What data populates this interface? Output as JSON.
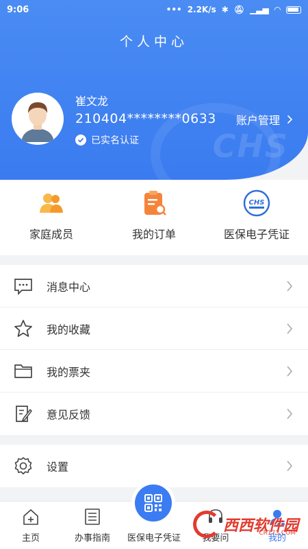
{
  "status_bar": {
    "time": "9:06",
    "speed": "2.2K/s"
  },
  "header": {
    "title": "个人中心",
    "user_name": "崔文龙",
    "user_id": "210404********0633",
    "verified_text": "已实名认证",
    "account_manage": "账户管理",
    "watermark": "CHS"
  },
  "quick_actions": [
    {
      "label": "家庭成员",
      "icon": "family-icon"
    },
    {
      "label": "我的订单",
      "icon": "order-icon"
    },
    {
      "label": "医保电子凭证",
      "icon": "chs-icon"
    }
  ],
  "chs_small_text": "CHS",
  "menu": [
    {
      "label": "消息中心",
      "icon": "message-icon"
    },
    {
      "label": "我的收藏",
      "icon": "star-icon"
    },
    {
      "label": "我的票夹",
      "icon": "folder-icon"
    },
    {
      "label": "意见反馈",
      "icon": "feedback-icon"
    }
  ],
  "settings": {
    "label": "设置",
    "icon": "gear-icon"
  },
  "tabbar": [
    {
      "label": "主页",
      "icon": "home-icon"
    },
    {
      "label": "办事指南",
      "icon": "guide-icon"
    },
    {
      "label": "医保电子凭证",
      "icon": "qr-icon"
    },
    {
      "label": "我要问",
      "icon": "headset-icon"
    },
    {
      "label": "我的",
      "icon": "user-icon"
    }
  ],
  "watermark_logo": {
    "text": "西西软件园",
    "sub": "CR173.COM"
  },
  "colors": {
    "primary": "#3a7bf0",
    "orange": "#f5a623"
  }
}
